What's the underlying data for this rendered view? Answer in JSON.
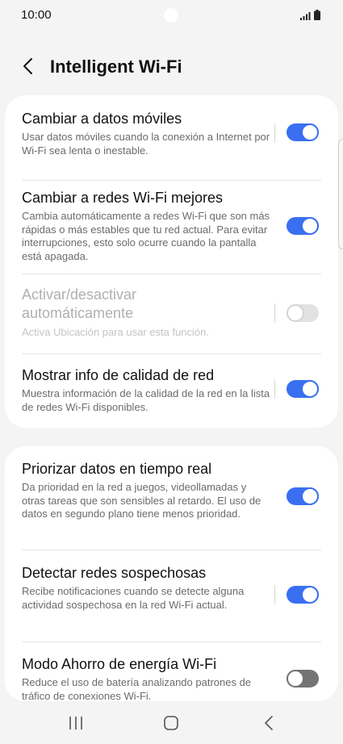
{
  "status_bar": {
    "time": "10:00"
  },
  "header": {
    "title": "Intelligent Wi-Fi",
    "back_icon": "chevron-left-icon"
  },
  "settings": [
    {
      "title": "Cambiar a datos móviles",
      "description": "Usar datos móviles cuando la conexión a Internet por Wi-Fi sea lenta o inestable.",
      "toggle": "on",
      "enabled": true
    },
    {
      "title": "Cambiar a redes Wi-Fi mejores",
      "description": "Cambia automáticamente a redes Wi-Fi que son más rápidas o más estables que tu red actual. Para evitar interrupciones, esto solo ocurre cuando la pantalla está apagada.",
      "toggle": "on",
      "enabled": true
    },
    {
      "title": "Activar/desactivar automáticamente",
      "description": "Activa Ubicación para usar esta función.",
      "toggle": "off",
      "enabled": false
    },
    {
      "title": "Mostrar info de calidad de red",
      "description": "Muestra información de la calidad de la red en la lista de redes Wi-Fi disponibles.",
      "toggle": "on",
      "enabled": true
    },
    {
      "title": "Priorizar datos en tiempo real",
      "description": "Da prioridad en la red a juegos, videollamadas y otras tareas que son sensibles al retardo. El uso de datos en segundo plano tiene menos prioridad.",
      "toggle": "on",
      "enabled": true
    },
    {
      "title": "Detectar redes sospechosas",
      "description": "Recibe notificaciones cuando se detecte alguna actividad sospechosa en la red Wi-Fi actual.",
      "toggle": "on",
      "enabled": true
    },
    {
      "title": "Modo Ahorro de energía Wi-Fi",
      "description": "Reduce el uso de batería analizando patrones de tráfico de conexiones Wi-Fi.",
      "toggle": "off",
      "enabled": true
    }
  ],
  "colors": {
    "accent": "#3a6ff2",
    "background": "#f4f4f4",
    "card": "#ffffff",
    "toggle_off": "#747474"
  },
  "nav_bar": {
    "icons": [
      "recent-apps-icon",
      "home-icon",
      "back-icon"
    ]
  }
}
